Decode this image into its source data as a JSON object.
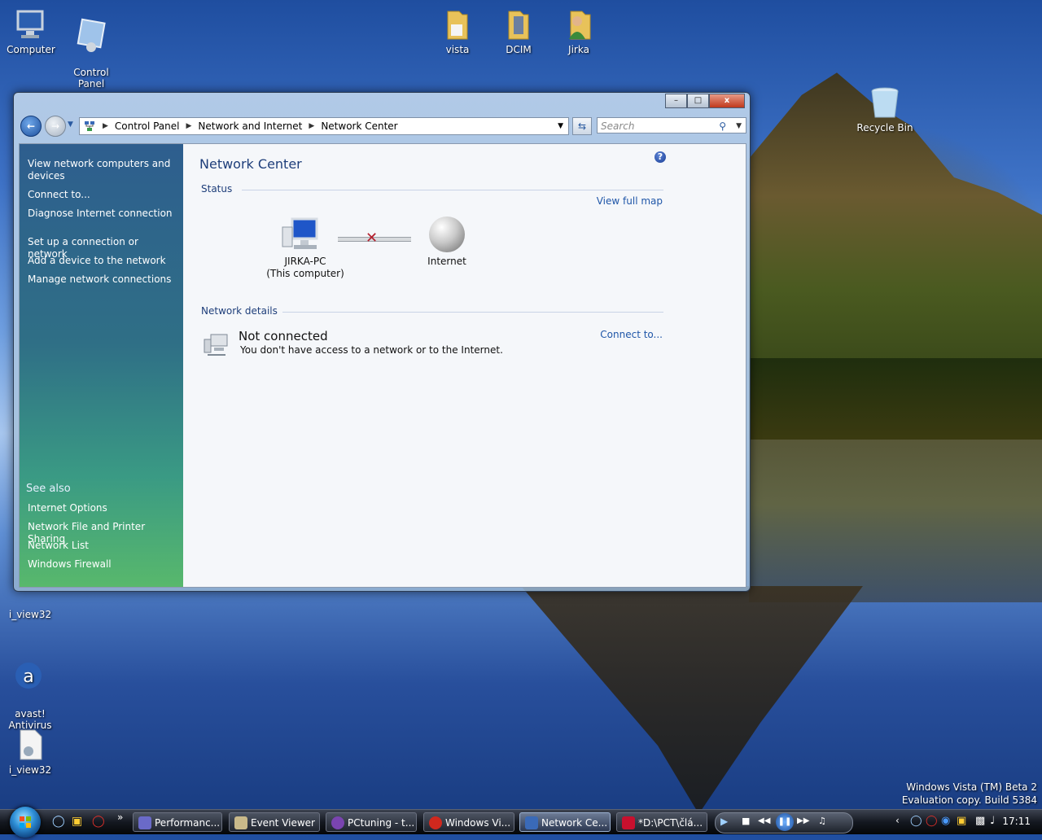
{
  "desktop": {
    "icons": [
      {
        "label": "Computer"
      },
      {
        "label": "Control\nPanel"
      },
      {
        "label": "vista"
      },
      {
        "label": "DCIM"
      },
      {
        "label": "Jirka"
      },
      {
        "label": "Recycle Bin"
      },
      {
        "label": "i_view32"
      },
      {
        "label": "avast!\nAntivirus"
      },
      {
        "label": "i_view32"
      }
    ],
    "watermark_line1": "Windows Vista (TM) Beta 2",
    "watermark_line2": "Evaluation copy. Build 5384"
  },
  "window": {
    "controls": {
      "minimize": "–",
      "maximize": "□",
      "close": "x"
    },
    "breadcrumb": [
      "Control Panel",
      "Network and Internet",
      "Network Center"
    ],
    "search_placeholder": "Search",
    "left_tasks": [
      "View network computers and devices",
      "Connect to...",
      "Diagnose Internet connection",
      "Set up a connection or network",
      "Add a device to the network",
      "Manage network connections"
    ],
    "see_also_title": "See also",
    "see_also": [
      "Internet Options",
      "Network File and Printer Sharing",
      "Network List",
      "Windows Firewall"
    ],
    "title": "Network Center",
    "status_section": "Status",
    "view_full_map": "View full map",
    "computer_name": "JIRKA-PC",
    "computer_sub": "(This computer)",
    "internet_label": "Internet",
    "details_section": "Network details",
    "conn_title": "Not connected",
    "conn_desc": "You don't have access to a network or to the Internet.",
    "connect_link": "Connect to..."
  },
  "taskbar": {
    "buttons": [
      {
        "label": "Performanc...",
        "active": false
      },
      {
        "label": "Event Viewer",
        "active": false
      },
      {
        "label": "PCtuning - t...",
        "active": false
      },
      {
        "label": "Windows Vi...",
        "active": false
      },
      {
        "label": "Network Ce...",
        "active": true
      },
      {
        "label": "*D:\\PCT\\člá...",
        "active": false
      }
    ],
    "clock": "17:11"
  },
  "colors": {
    "link": "#1f56a8",
    "heading": "#1e3e7a",
    "error_x": "#b4202e"
  }
}
